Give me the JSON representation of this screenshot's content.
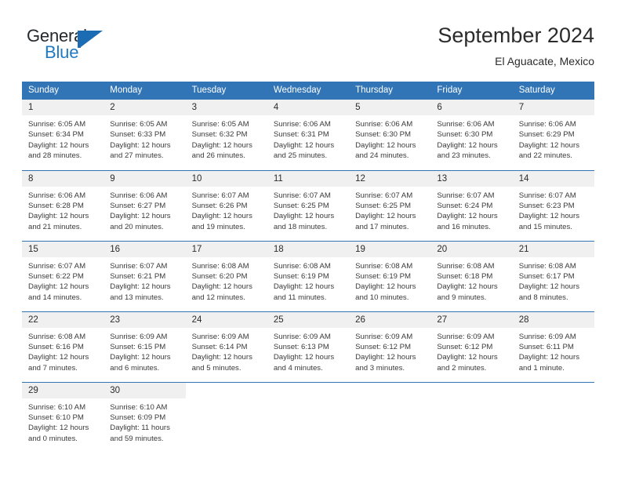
{
  "brand": {
    "name_top": "General",
    "name_bottom": "Blue",
    "color_dark": "#25282c",
    "color_blue": "#1f7ac4",
    "flag_icon": "blue-triangle-flag-icon"
  },
  "header": {
    "month_title": "September 2024",
    "location": "El Aguacate, Mexico"
  },
  "theme": {
    "header_blue": "#3275b6",
    "daynum_gray": "#f0f0f0",
    "text_color": "#3a3a3a"
  },
  "weekday_headers": [
    "Sunday",
    "Monday",
    "Tuesday",
    "Wednesday",
    "Thursday",
    "Friday",
    "Saturday"
  ],
  "weeks": [
    [
      {
        "day": "1",
        "sunrise": "Sunrise: 6:05 AM",
        "sunset": "Sunset: 6:34 PM",
        "daylight1": "Daylight: 12 hours",
        "daylight2": "and 28 minutes."
      },
      {
        "day": "2",
        "sunrise": "Sunrise: 6:05 AM",
        "sunset": "Sunset: 6:33 PM",
        "daylight1": "Daylight: 12 hours",
        "daylight2": "and 27 minutes."
      },
      {
        "day": "3",
        "sunrise": "Sunrise: 6:05 AM",
        "sunset": "Sunset: 6:32 PM",
        "daylight1": "Daylight: 12 hours",
        "daylight2": "and 26 minutes."
      },
      {
        "day": "4",
        "sunrise": "Sunrise: 6:06 AM",
        "sunset": "Sunset: 6:31 PM",
        "daylight1": "Daylight: 12 hours",
        "daylight2": "and 25 minutes."
      },
      {
        "day": "5",
        "sunrise": "Sunrise: 6:06 AM",
        "sunset": "Sunset: 6:30 PM",
        "daylight1": "Daylight: 12 hours",
        "daylight2": "and 24 minutes."
      },
      {
        "day": "6",
        "sunrise": "Sunrise: 6:06 AM",
        "sunset": "Sunset: 6:30 PM",
        "daylight1": "Daylight: 12 hours",
        "daylight2": "and 23 minutes."
      },
      {
        "day": "7",
        "sunrise": "Sunrise: 6:06 AM",
        "sunset": "Sunset: 6:29 PM",
        "daylight1": "Daylight: 12 hours",
        "daylight2": "and 22 minutes."
      }
    ],
    [
      {
        "day": "8",
        "sunrise": "Sunrise: 6:06 AM",
        "sunset": "Sunset: 6:28 PM",
        "daylight1": "Daylight: 12 hours",
        "daylight2": "and 21 minutes."
      },
      {
        "day": "9",
        "sunrise": "Sunrise: 6:06 AM",
        "sunset": "Sunset: 6:27 PM",
        "daylight1": "Daylight: 12 hours",
        "daylight2": "and 20 minutes."
      },
      {
        "day": "10",
        "sunrise": "Sunrise: 6:07 AM",
        "sunset": "Sunset: 6:26 PM",
        "daylight1": "Daylight: 12 hours",
        "daylight2": "and 19 minutes."
      },
      {
        "day": "11",
        "sunrise": "Sunrise: 6:07 AM",
        "sunset": "Sunset: 6:25 PM",
        "daylight1": "Daylight: 12 hours",
        "daylight2": "and 18 minutes."
      },
      {
        "day": "12",
        "sunrise": "Sunrise: 6:07 AM",
        "sunset": "Sunset: 6:25 PM",
        "daylight1": "Daylight: 12 hours",
        "daylight2": "and 17 minutes."
      },
      {
        "day": "13",
        "sunrise": "Sunrise: 6:07 AM",
        "sunset": "Sunset: 6:24 PM",
        "daylight1": "Daylight: 12 hours",
        "daylight2": "and 16 minutes."
      },
      {
        "day": "14",
        "sunrise": "Sunrise: 6:07 AM",
        "sunset": "Sunset: 6:23 PM",
        "daylight1": "Daylight: 12 hours",
        "daylight2": "and 15 minutes."
      }
    ],
    [
      {
        "day": "15",
        "sunrise": "Sunrise: 6:07 AM",
        "sunset": "Sunset: 6:22 PM",
        "daylight1": "Daylight: 12 hours",
        "daylight2": "and 14 minutes."
      },
      {
        "day": "16",
        "sunrise": "Sunrise: 6:07 AM",
        "sunset": "Sunset: 6:21 PM",
        "daylight1": "Daylight: 12 hours",
        "daylight2": "and 13 minutes."
      },
      {
        "day": "17",
        "sunrise": "Sunrise: 6:08 AM",
        "sunset": "Sunset: 6:20 PM",
        "daylight1": "Daylight: 12 hours",
        "daylight2": "and 12 minutes."
      },
      {
        "day": "18",
        "sunrise": "Sunrise: 6:08 AM",
        "sunset": "Sunset: 6:19 PM",
        "daylight1": "Daylight: 12 hours",
        "daylight2": "and 11 minutes."
      },
      {
        "day": "19",
        "sunrise": "Sunrise: 6:08 AM",
        "sunset": "Sunset: 6:19 PM",
        "daylight1": "Daylight: 12 hours",
        "daylight2": "and 10 minutes."
      },
      {
        "day": "20",
        "sunrise": "Sunrise: 6:08 AM",
        "sunset": "Sunset: 6:18 PM",
        "daylight1": "Daylight: 12 hours",
        "daylight2": "and 9 minutes."
      },
      {
        "day": "21",
        "sunrise": "Sunrise: 6:08 AM",
        "sunset": "Sunset: 6:17 PM",
        "daylight1": "Daylight: 12 hours",
        "daylight2": "and 8 minutes."
      }
    ],
    [
      {
        "day": "22",
        "sunrise": "Sunrise: 6:08 AM",
        "sunset": "Sunset: 6:16 PM",
        "daylight1": "Daylight: 12 hours",
        "daylight2": "and 7 minutes."
      },
      {
        "day": "23",
        "sunrise": "Sunrise: 6:09 AM",
        "sunset": "Sunset: 6:15 PM",
        "daylight1": "Daylight: 12 hours",
        "daylight2": "and 6 minutes."
      },
      {
        "day": "24",
        "sunrise": "Sunrise: 6:09 AM",
        "sunset": "Sunset: 6:14 PM",
        "daylight1": "Daylight: 12 hours",
        "daylight2": "and 5 minutes."
      },
      {
        "day": "25",
        "sunrise": "Sunrise: 6:09 AM",
        "sunset": "Sunset: 6:13 PM",
        "daylight1": "Daylight: 12 hours",
        "daylight2": "and 4 minutes."
      },
      {
        "day": "26",
        "sunrise": "Sunrise: 6:09 AM",
        "sunset": "Sunset: 6:12 PM",
        "daylight1": "Daylight: 12 hours",
        "daylight2": "and 3 minutes."
      },
      {
        "day": "27",
        "sunrise": "Sunrise: 6:09 AM",
        "sunset": "Sunset: 6:12 PM",
        "daylight1": "Daylight: 12 hours",
        "daylight2": "and 2 minutes."
      },
      {
        "day": "28",
        "sunrise": "Sunrise: 6:09 AM",
        "sunset": "Sunset: 6:11 PM",
        "daylight1": "Daylight: 12 hours",
        "daylight2": "and 1 minute."
      }
    ],
    [
      {
        "day": "29",
        "sunrise": "Sunrise: 6:10 AM",
        "sunset": "Sunset: 6:10 PM",
        "daylight1": "Daylight: 12 hours",
        "daylight2": "and 0 minutes."
      },
      {
        "day": "30",
        "sunrise": "Sunrise: 6:10 AM",
        "sunset": "Sunset: 6:09 PM",
        "daylight1": "Daylight: 11 hours",
        "daylight2": "and 59 minutes."
      },
      {
        "day": "",
        "sunrise": "",
        "sunset": "",
        "daylight1": "",
        "daylight2": ""
      },
      {
        "day": "",
        "sunrise": "",
        "sunset": "",
        "daylight1": "",
        "daylight2": ""
      },
      {
        "day": "",
        "sunrise": "",
        "sunset": "",
        "daylight1": "",
        "daylight2": ""
      },
      {
        "day": "",
        "sunrise": "",
        "sunset": "",
        "daylight1": "",
        "daylight2": ""
      },
      {
        "day": "",
        "sunrise": "",
        "sunset": "",
        "daylight1": "",
        "daylight2": ""
      }
    ]
  ]
}
